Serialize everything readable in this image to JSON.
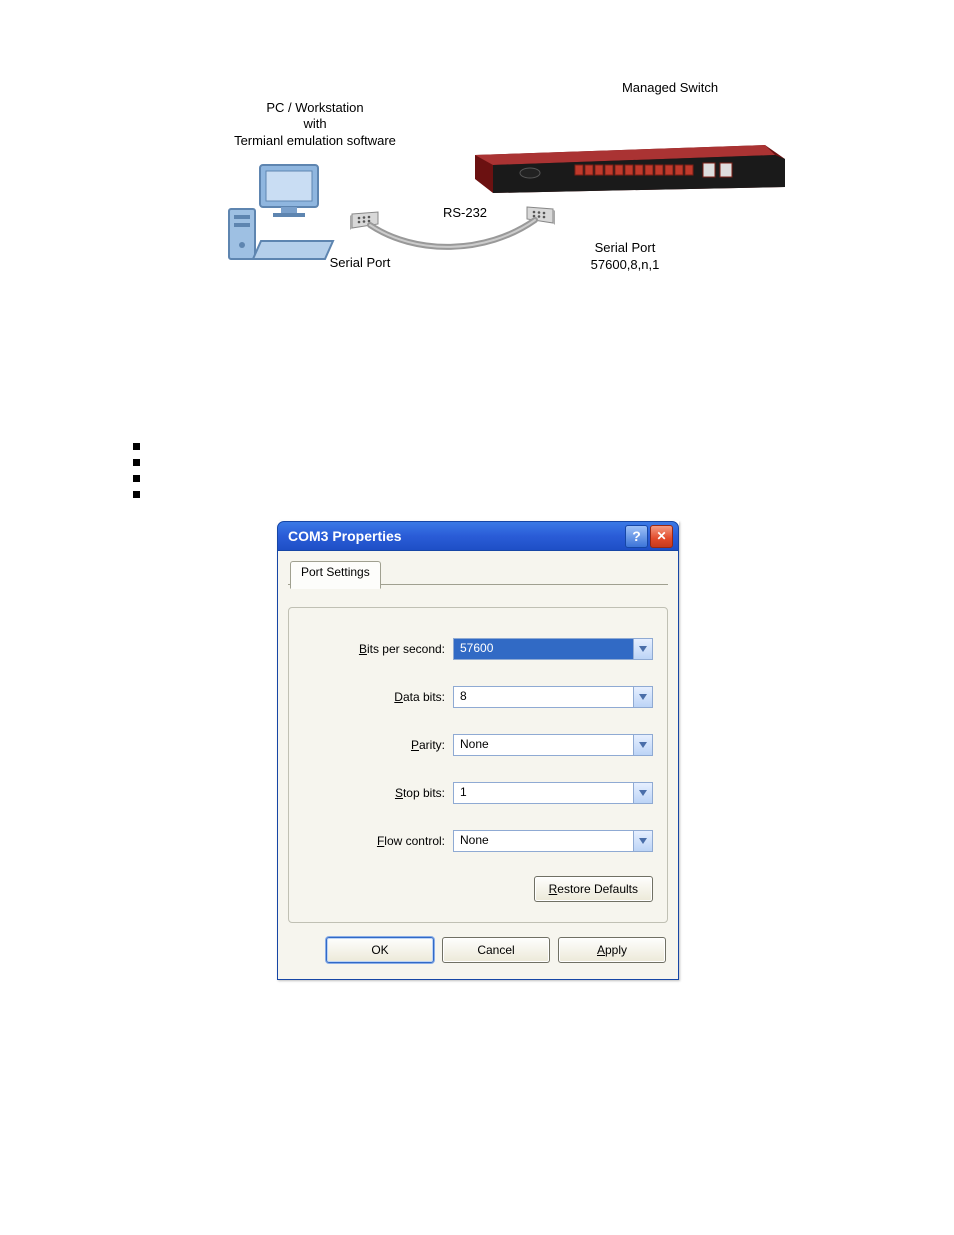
{
  "diagram": {
    "left_label_line1": "PC / Workstation",
    "left_label_line2": "with",
    "left_label_line3": "Termianl emulation software",
    "right_label": "Managed Switch",
    "serial_port_left": "Serial Port",
    "cable_label": "RS-232",
    "serial_port_right_line1": "Serial Port",
    "serial_port_right_line2": "57600,8,n,1"
  },
  "dialog": {
    "title": "COM3 Properties",
    "tab_label": "Port Settings",
    "fields": {
      "bits_per_second": {
        "label_pre": "B",
        "label_post": "its per second:",
        "value": "57600"
      },
      "data_bits": {
        "label_pre": "D",
        "label_post": "ata bits:",
        "value": "8"
      },
      "parity": {
        "label_pre": "P",
        "label_post": "arity:",
        "value": "None"
      },
      "stop_bits": {
        "label_pre": "S",
        "label_post": "top bits:",
        "value": "1"
      },
      "flow_control": {
        "label_pre": "F",
        "label_post": "low control:",
        "value": "None"
      }
    },
    "restore_pre": "R",
    "restore_post": "estore Defaults",
    "ok": "OK",
    "cancel": "Cancel",
    "apply_pre": "A",
    "apply_post": "pply",
    "help_glyph": "?",
    "close_glyph": "✕"
  }
}
